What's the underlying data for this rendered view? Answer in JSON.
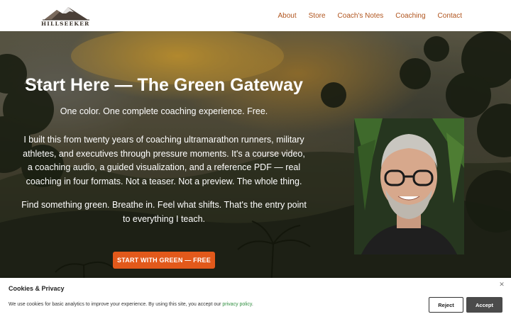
{
  "brand": {
    "name": "HILLSEEKER",
    "logo_icon": "mountain-icon"
  },
  "nav": {
    "items": [
      {
        "label": "About"
      },
      {
        "label": "Store"
      },
      {
        "label": "Coach's Notes"
      },
      {
        "label": "Coaching"
      },
      {
        "label": "Contact"
      }
    ]
  },
  "hero": {
    "title": "Start Here — The Green Gateway",
    "subtitle": "One color. One complete coaching experience. Free.",
    "paragraph1": "I built this from twenty years of coaching ultramarathon runners, military athletes, and executives through pressure moments. It's a course video, a coaching audio, a guided visualization, and a reference PDF — real coaching in four formats. Not a teaser. Not a preview. The whole thing.",
    "paragraph2": "Find something green. Breathe in. Feel what shifts. That's the entry point to everything I teach.",
    "cta_label": "START WITH GREEN — FREE",
    "accent": "#e2591b"
  },
  "cookie": {
    "title": "Cookies & Privacy",
    "text_before": "We use cookies for basic analytics to improve your experience. By using this site, you accept our ",
    "link_label": "privacy policy",
    "text_after": ".",
    "reject_label": "Reject",
    "accept_label": "Accept",
    "close_icon": "close-icon"
  }
}
